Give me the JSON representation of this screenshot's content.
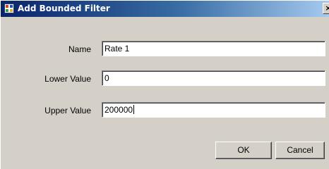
{
  "window": {
    "title": "Add Bounded Filter",
    "close_glyph": "×"
  },
  "form": {
    "name": {
      "label": "Name",
      "value": "Rate 1"
    },
    "lower": {
      "label": "Lower Value",
      "value": "0"
    },
    "upper": {
      "label": "Upper Value",
      "value": "200000"
    }
  },
  "buttons": {
    "ok_label": "OK",
    "cancel_label": "Cancel"
  },
  "colors": {
    "titlebar_start": "#0a246a",
    "titlebar_end": "#a6caf0",
    "dialog_background": "#d4d0c8"
  },
  "icons": {
    "title": "app-window-icon",
    "close": "close-icon"
  }
}
